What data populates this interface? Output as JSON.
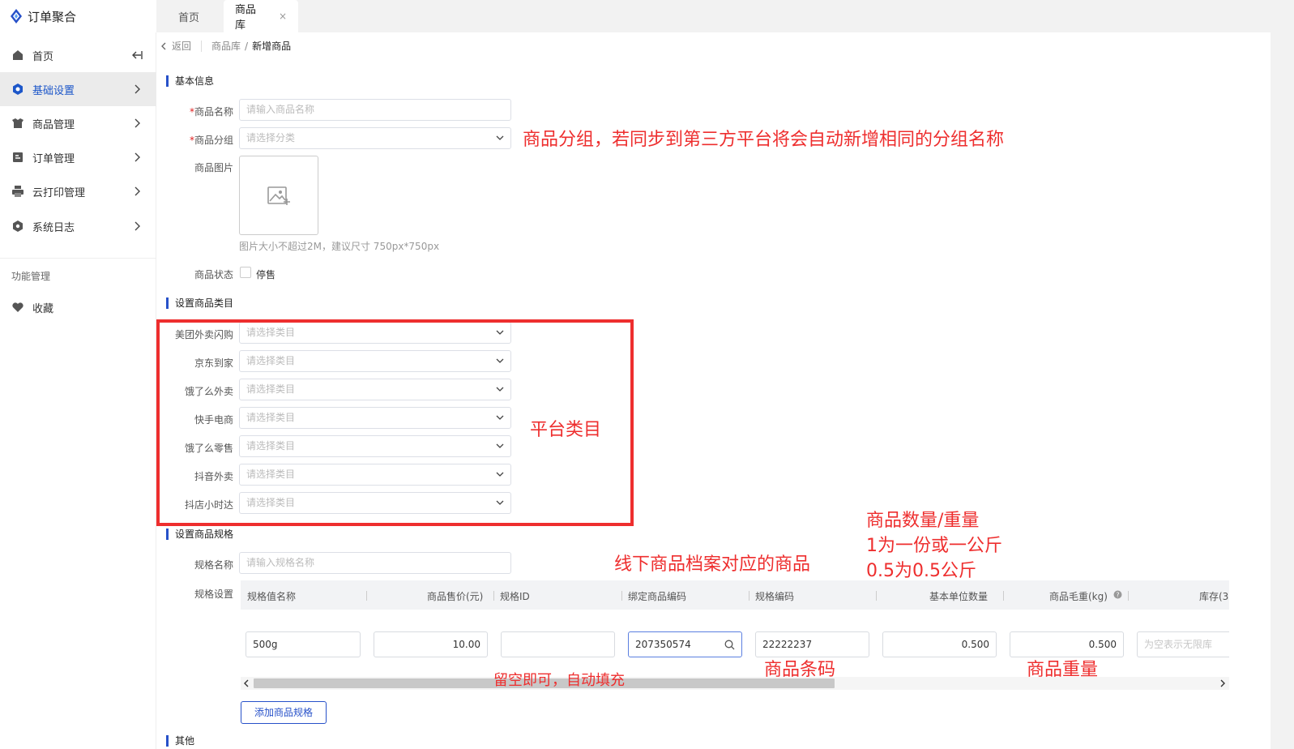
{
  "app": {
    "title": "订单聚合"
  },
  "tabs": [
    {
      "label": "首页"
    },
    {
      "label": "商品库",
      "close": "×"
    }
  ],
  "sidebar": {
    "items": [
      {
        "label": "首页"
      },
      {
        "label": "基础设置"
      },
      {
        "label": "商品管理"
      },
      {
        "label": "订单管理"
      },
      {
        "label": "云打印管理"
      },
      {
        "label": "系统日志"
      }
    ],
    "group_label": "功能管理",
    "favorites_label": "收藏"
  },
  "breadcrumb": {
    "back": "返回",
    "parent": "商品库",
    "separator": "/",
    "current": "新增商品"
  },
  "basic_info": {
    "title": "基本信息",
    "name_label": "商品名称",
    "name_placeholder": "请输入商品名称",
    "group_label": "商品分组",
    "group_placeholder": "请选择分类",
    "image_label": "商品图片",
    "image_hint": "图片大小不超过2M，建议尺寸 750px*750px",
    "status_label": "商品状态",
    "status_option": "停售",
    "required_mark": "*"
  },
  "category": {
    "title": "设置商品类目",
    "placeholder": "请选择类目",
    "platforms": [
      {
        "label": "美团外卖闪购"
      },
      {
        "label": "京东到家"
      },
      {
        "label": "饿了么外卖"
      },
      {
        "label": "快手电商"
      },
      {
        "label": "饿了么零售"
      },
      {
        "label": "抖音外卖"
      },
      {
        "label": "抖店小时达"
      }
    ]
  },
  "spec": {
    "title": "设置商品规格",
    "name_label": "规格名称",
    "name_placeholder": "请输入规格名称",
    "settings_label": "规格设置",
    "columns": [
      "规格值名称",
      "商品售价(元)",
      "规格ID",
      "绑定商品编码",
      "规格编码",
      "基本单位数量",
      "商品毛重(kg)",
      "库存(3"
    ],
    "row": {
      "value_name": "500g",
      "price": "10.00",
      "spec_id": "",
      "bound_code": "207350574",
      "spec_code": "22222237",
      "unit_qty": "0.500",
      "weight": "0.500",
      "stock_placeholder": "为空表示无限库"
    },
    "add_button": "添加商品规格"
  },
  "other": {
    "title": "其他"
  },
  "annotations": {
    "group_note": "商品分组，若同步到第三方平台将会自动新增相同的分组名称",
    "platform_note": "平台类目",
    "qty_note_1": "商品数量/重量",
    "qty_note_2": "1为一份或一公斤",
    "qty_note_3": "0.5为0.5公斤",
    "offline_note": "线下商品档案对应的商品",
    "spec_id_note": "留空即可，自动填充",
    "barcode_note": "商品条码",
    "weight_note": "商品重量"
  },
  "colors": {
    "accent": "#2751c9",
    "annotation": "#ee2e2e",
    "active_menu": "#1d57c9"
  },
  "icons": [
    "logo-icon",
    "home-icon",
    "settings-icon",
    "goods-icon",
    "order-icon",
    "printer-icon",
    "log-icon",
    "heart-icon",
    "chevron-right-icon",
    "collapse-icon",
    "back-icon",
    "image-upload-icon",
    "search-icon",
    "chevron-down-icon"
  ]
}
